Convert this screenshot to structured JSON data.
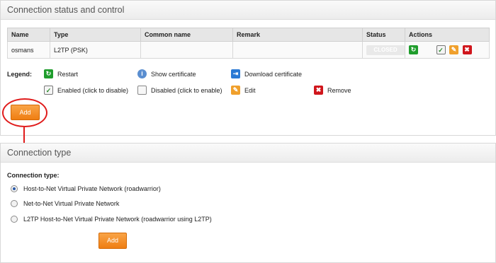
{
  "colors": {
    "accent": "#f08a1e",
    "highlight": "#e01b1b",
    "restart": "#1f9d2c",
    "download": "#2a79d4",
    "remove": "#d0161c"
  },
  "status_panel": {
    "title": "Connection status and control",
    "columns": [
      "Name",
      "Type",
      "Common name",
      "Remark",
      "Status",
      "Actions"
    ],
    "rows": [
      {
        "name": "osmans",
        "type": "L2TP (PSK)",
        "common_name": "",
        "remark": "",
        "status": "CLOSED"
      }
    ],
    "legend": {
      "label": "Legend:",
      "restart": "Restart",
      "show_certificate": "Show certificate",
      "download_certificate": "Download certificate",
      "enabled": "Enabled (click to disable)",
      "disabled": "Disabled (click to enable)",
      "edit": "Edit",
      "remove": "Remove"
    },
    "add_button": "Add"
  },
  "type_panel": {
    "title": "Connection type",
    "label": "Connection type:",
    "options": [
      {
        "label": "Host-to-Net Virtual Private Network (roadwarrior)",
        "selected": true
      },
      {
        "label": "Net-to-Net Virtual Private Network",
        "selected": false
      },
      {
        "label": "L2TP Host-to-Net Virtual Private Network (roadwarrior using L2TP)",
        "selected": false
      }
    ],
    "add_button": "Add"
  }
}
